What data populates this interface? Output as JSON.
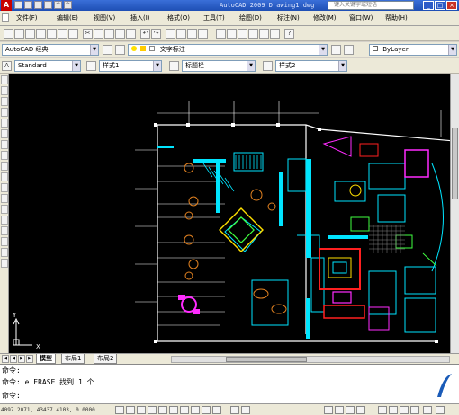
{
  "app": {
    "logo_letter": "A",
    "window_title": "AutoCAD 2009 Drawing1.dwg",
    "search_placeholder": "键入关键字或短语",
    "window_buttons": [
      "_",
      "□",
      "×"
    ]
  },
  "menu": {
    "items": [
      "文件(F)",
      "编辑(E)",
      "视图(V)",
      "插入(I)",
      "格式(O)",
      "工具(T)",
      "绘图(D)",
      "标注(N)",
      "修改(M)",
      "窗口(W)",
      "帮助(H)"
    ]
  },
  "toolbar": {
    "workspace": "AutoCAD 经典",
    "text_style_label": "文字标注",
    "layer": "ByLayer",
    "text_style": "Standard",
    "dim_style": "样式1",
    "table_style": "标题栏",
    "multileader_style": "样式2"
  },
  "tabs": {
    "items": [
      "模型",
      "布局1",
      "布局2"
    ]
  },
  "command": {
    "lines": [
      "命令:",
      "命令: e ERASE 找到 1 个",
      "命令:"
    ]
  },
  "status": {
    "coordinates": "4097.2071, 43437.4103, 0.0000"
  },
  "ucs": {
    "x_label": "X",
    "y_label": "Y"
  },
  "colors": {
    "titlebar": "#1e4fb4",
    "canvas": "#000000",
    "wall": "#ffffff",
    "cyan": "#00e5ff",
    "magenta": "#ff2bff",
    "red": "#ff2020",
    "yellow": "#ffe000",
    "green": "#40ff40",
    "orange": "#e08020"
  }
}
